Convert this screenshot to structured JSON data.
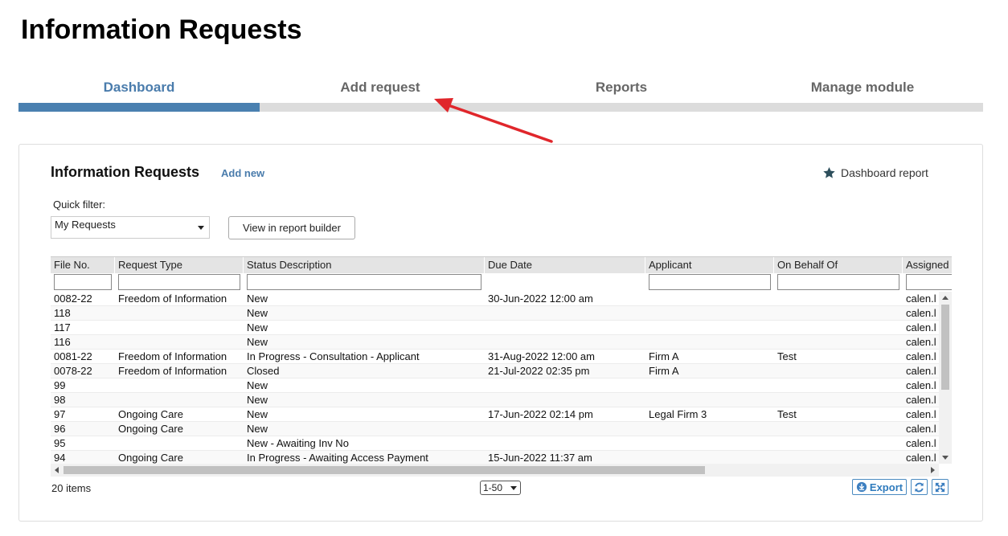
{
  "page": {
    "title": "Information Requests"
  },
  "tabs": [
    {
      "label": "Dashboard",
      "active": true
    },
    {
      "label": "Add request",
      "active": false
    },
    {
      "label": "Reports",
      "active": false
    },
    {
      "label": "Manage module",
      "active": false
    }
  ],
  "panel": {
    "title": "Information Requests",
    "add_new": "Add new",
    "dashboard_report": "Dashboard report",
    "quick_filter_label": "Quick filter:",
    "quick_filter_value": "My Requests",
    "view_report_builder": "View in report builder"
  },
  "grid": {
    "columns": [
      "File No.",
      "Request Type",
      "Status Description",
      "Due Date",
      "Applicant",
      "On Behalf Of",
      "Assigned"
    ],
    "rows": [
      [
        "0082-22",
        "Freedom of Information",
        "New",
        "30-Jun-2022 12:00 am",
        "",
        "",
        "calen.l"
      ],
      [
        "118",
        "",
        "New",
        "",
        "",
        "",
        "calen.l"
      ],
      [
        "117",
        "",
        "New",
        "",
        "",
        "",
        "calen.l"
      ],
      [
        "116",
        "",
        "New",
        "",
        "",
        "",
        "calen.l"
      ],
      [
        "0081-22",
        "Freedom of Information",
        "In Progress - Consultation - Applicant",
        "31-Aug-2022 12:00 am",
        "Firm A",
        "Test",
        "calen.l"
      ],
      [
        "0078-22",
        "Freedom of Information",
        "Closed",
        "21-Jul-2022 02:35 pm",
        "Firm A",
        "",
        "calen.l"
      ],
      [
        "99",
        "",
        "New",
        "",
        "",
        "",
        "calen.l"
      ],
      [
        "98",
        "",
        "New",
        "",
        "",
        "",
        "calen.l"
      ],
      [
        "97",
        "Ongoing Care",
        "New",
        "17-Jun-2022 02:14 pm",
        "Legal Firm 3",
        "Test",
        "calen.l"
      ],
      [
        "96",
        "Ongoing Care",
        "New",
        "",
        "",
        "",
        "calen.l"
      ],
      [
        "95",
        "",
        "New - Awaiting Inv No",
        "",
        "",
        "",
        "calen.l"
      ],
      [
        "94",
        "Ongoing Care",
        "In Progress - Awaiting Access Payment",
        "15-Jun-2022 11:37 am",
        "",
        "",
        "calen.l"
      ]
    ]
  },
  "footer": {
    "items_count": "20 items",
    "page_range": "1-50",
    "export_label": "Export"
  },
  "colors": {
    "accent": "#4a80b0",
    "arrow": "#e0262b"
  },
  "icons": [
    "star-icon",
    "download-icon",
    "refresh-icon",
    "expand-icon"
  ]
}
